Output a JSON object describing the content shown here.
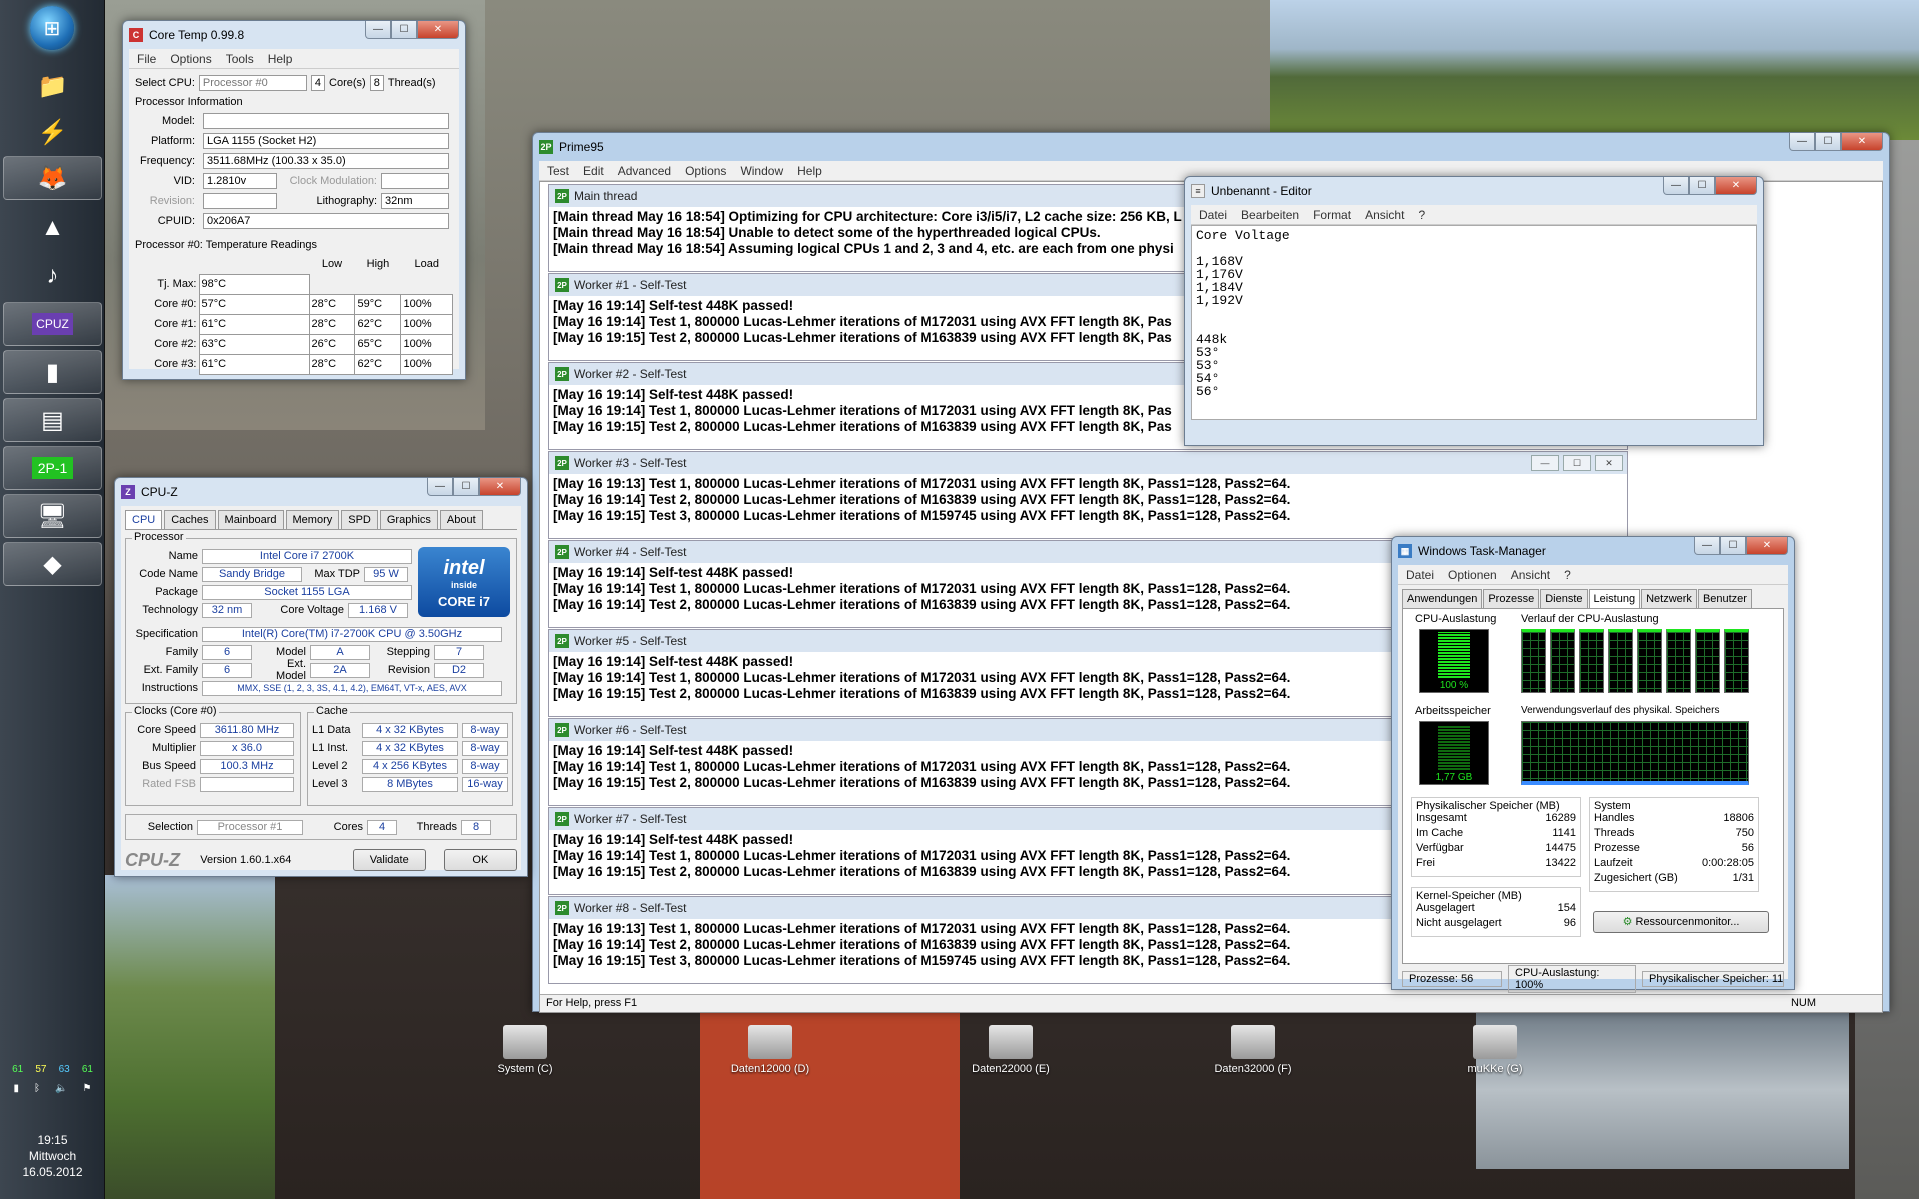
{
  "taskbar": {
    "items": [
      "start-orb",
      "libraries",
      "winamp",
      "firefox",
      "vlc",
      "itunes",
      "cpu-z",
      "prime95",
      "hardware-monitor",
      "task-manager",
      "windows-explorer"
    ],
    "tray_temps": {
      "t1": "61",
      "t2": "57",
      "t3": "63",
      "t4": "61"
    },
    "clock_time": "19:15",
    "clock_day": "Mittwoch",
    "clock_date": "16.05.2012"
  },
  "coretemp": {
    "title": "Core Temp 0.99.8",
    "menu": [
      "File",
      "Options",
      "Tools",
      "Help"
    ],
    "select_cpu_label": "Select CPU:",
    "select_cpu_value": "Processor #0",
    "cores": "4",
    "cores_label": "Core(s)",
    "threads": "8",
    "threads_label": "Thread(s)",
    "info_header": "Processor Information",
    "model_label": "Model:",
    "model_value": "",
    "platform_label": "Platform:",
    "platform_value": "LGA 1155 (Socket H2)",
    "frequency_label": "Frequency:",
    "frequency_value": "3511.68MHz (100.33 x 35.0)",
    "vid_label": "VID:",
    "vid_value": "1.2810v",
    "clock_mod_label": "Clock Modulation:",
    "revision_label": "Revision:",
    "lithography_label": "Lithography:",
    "lithography_value": "32nm",
    "cpuid_label": "CPUID:",
    "cpuid_value": "0x206A7",
    "temp_header": "Processor #0: Temperature Readings",
    "cols": [
      "Low",
      "High",
      "Load"
    ],
    "tjmax_label": "Tj. Max:",
    "tjmax_value": "98°C",
    "cores_rows": [
      {
        "name": "Core #0:",
        "temp": "57°C",
        "low": "28°C",
        "high": "59°C",
        "load": "100%"
      },
      {
        "name": "Core #1:",
        "temp": "61°C",
        "low": "28°C",
        "high": "62°C",
        "load": "100%"
      },
      {
        "name": "Core #2:",
        "temp": "63°C",
        "low": "26°C",
        "high": "65°C",
        "load": "100%"
      },
      {
        "name": "Core #3:",
        "temp": "61°C",
        "low": "28°C",
        "high": "62°C",
        "load": "100%"
      }
    ]
  },
  "cpuz": {
    "title": "CPU-Z",
    "tabs": [
      "CPU",
      "Caches",
      "Mainboard",
      "Memory",
      "SPD",
      "Graphics",
      "About"
    ],
    "processor_group": "Processor",
    "name_label": "Name",
    "name_value": "Intel Core i7 2700K",
    "codename_label": "Code Name",
    "codename_value": "Sandy Bridge",
    "maxtdp_label": "Max TDP",
    "maxtdp_value": "95 W",
    "package_label": "Package",
    "package_value": "Socket 1155 LGA",
    "technology_label": "Technology",
    "technology_value": "32 nm",
    "corevoltage_label": "Core Voltage",
    "corevoltage_value": "1.168 V",
    "intel_line1": "intel",
    "intel_line2": "inside",
    "intel_line3": "CORE i7",
    "spec_label": "Specification",
    "spec_value": "Intel(R) Core(TM) i7-2700K CPU @ 3.50GHz",
    "family_label": "Family",
    "family_value": "6",
    "model_label": "Model",
    "model_value": "A",
    "stepping_label": "Stepping",
    "stepping_value": "7",
    "extfamily_label": "Ext. Family",
    "extfamily_value": "6",
    "extmodel_label": "Ext. Model",
    "extmodel_value": "2A",
    "revision_label": "Revision",
    "revision_value": "D2",
    "instr_label": "Instructions",
    "instr_value": "MMX, SSE (1, 2, 3, 3S, 4.1, 4.2), EM64T, VT-x, AES, AVX",
    "clocks_group": "Clocks (Core #0)",
    "corespeed_label": "Core Speed",
    "corespeed_value": "3611.80 MHz",
    "multiplier_label": "Multiplier",
    "multiplier_value": "x 36.0",
    "busspeed_label": "Bus Speed",
    "busspeed_value": "100.3 MHz",
    "ratedfsb_label": "Rated FSB",
    "cache_group": "Cache",
    "cache_rows": [
      {
        "name": "L1 Data",
        "size": "4 x 32 KBytes",
        "way": "8-way"
      },
      {
        "name": "L1 Inst.",
        "size": "4 x 32 KBytes",
        "way": "8-way"
      },
      {
        "name": "Level 2",
        "size": "4 x 256 KBytes",
        "way": "8-way"
      },
      {
        "name": "Level 3",
        "size": "8 MBytes",
        "way": "16-way"
      }
    ],
    "selection_label": "Selection",
    "selection_value": "Processor #1",
    "cores_label": "Cores",
    "cores_value": "4",
    "threads_label": "Threads",
    "threads_value": "8",
    "logo": "CPU-Z",
    "version": "Version 1.60.1.x64",
    "validate": "Validate",
    "ok": "OK"
  },
  "prime95": {
    "title": "Prime95",
    "menu": [
      "Test",
      "Edit",
      "Advanced",
      "Options",
      "Window",
      "Help"
    ],
    "children": [
      {
        "title": "Main thread",
        "lines": [
          "[Main thread May 16 18:54] Optimizing for CPU architecture: Core i3/i5/i7, L2 cache size: 256 KB, L",
          "[Main thread May 16 18:54] Unable to detect some of the hyperthreaded logical CPUs.",
          "[Main thread May 16 18:54] Assuming logical CPUs 1 and 2, 3 and 4, etc. are each from one physi"
        ]
      },
      {
        "title": "Worker #1 - Self-Test",
        "lines": [
          "[May 16 19:14] Self-test 448K passed!",
          "[May 16 19:14] Test 1, 800000 Lucas-Lehmer iterations of M172031 using AVX FFT length 8K, Pas",
          "[May 16 19:15] Test 2, 800000 Lucas-Lehmer iterations of M163839 using AVX FFT length 8K, Pas"
        ]
      },
      {
        "title": "Worker #2 - Self-Test",
        "lines": [
          "[May 16 19:14] Self-test 448K passed!",
          "[May 16 19:14] Test 1, 800000 Lucas-Lehmer iterations of M172031 using AVX FFT length 8K, Pas",
          "[May 16 19:15] Test 2, 800000 Lucas-Lehmer iterations of M163839 using AVX FFT length 8K, Pas"
        ]
      },
      {
        "title": "Worker #3 - Self-Test",
        "lines": [
          "[May 16 19:13] Test 1, 800000 Lucas-Lehmer iterations of M172031 using AVX FFT length 8K, Pass1=128, Pass2=64.",
          "[May 16 19:14] Test 2, 800000 Lucas-Lehmer iterations of M163839 using AVX FFT length 8K, Pass1=128, Pass2=64.",
          "[May 16 19:15] Test 3, 800000 Lucas-Lehmer iterations of M159745 using AVX FFT length 8K, Pass1=128, Pass2=64."
        ]
      },
      {
        "title": "Worker #4 - Self-Test",
        "lines": [
          "[May 16 19:14] Self-test 448K passed!",
          "[May 16 19:14] Test 1, 800000 Lucas-Lehmer iterations of M172031 using AVX FFT length 8K, Pass1=128, Pass2=64.",
          "[May 16 19:14] Test 2, 800000 Lucas-Lehmer iterations of M163839 using AVX FFT length 8K, Pass1=128, Pass2=64."
        ]
      },
      {
        "title": "Worker #5 - Self-Test",
        "lines": [
          "[May 16 19:14] Self-test 448K passed!",
          "[May 16 19:14] Test 1, 800000 Lucas-Lehmer iterations of M172031 using AVX FFT length 8K, Pass1=128, Pass2=64.",
          "[May 16 19:15] Test 2, 800000 Lucas-Lehmer iterations of M163839 using AVX FFT length 8K, Pass1=128, Pass2=64."
        ]
      },
      {
        "title": "Worker #6 - Self-Test",
        "lines": [
          "[May 16 19:14] Self-test 448K passed!",
          "[May 16 19:14] Test 1, 800000 Lucas-Lehmer iterations of M172031 using AVX FFT length 8K, Pass1=128, Pass2=64.",
          "[May 16 19:15] Test 2, 800000 Lucas-Lehmer iterations of M163839 using AVX FFT length 8K, Pass1=128, Pass2=64."
        ]
      },
      {
        "title": "Worker #7 - Self-Test",
        "lines": [
          "[May 16 19:14] Self-test 448K passed!",
          "[May 16 19:14] Test 1, 800000 Lucas-Lehmer iterations of M172031 using AVX FFT length 8K, Pass1=128, Pass2=64.",
          "[May 16 19:15] Test 2, 800000 Lucas-Lehmer iterations of M163839 using AVX FFT length 8K, Pass1=128, Pass2=64."
        ]
      },
      {
        "title": "Worker #8 - Self-Test",
        "lines": [
          "[May 16 19:13] Test 1, 800000 Lucas-Lehmer iterations of M172031 using AVX FFT length 8K, Pass1=128, Pass2=64.",
          "[May 16 19:14] Test 2, 800000 Lucas-Lehmer iterations of M163839 using AVX FFT length 8K, Pass1=128, Pass2=64.",
          "[May 16 19:15] Test 3, 800000 Lucas-Lehmer iterations of M159745 using AVX FFT length 8K, Pass1=128, Pass2=64."
        ]
      }
    ],
    "status": "For Help, press F1",
    "status_num": "NUM"
  },
  "editor": {
    "title": "Unbenannt - Editor",
    "menu": [
      "Datei",
      "Bearbeiten",
      "Format",
      "Ansicht",
      "?"
    ],
    "text": "Core Voltage\n\n1,168V\n1,176V\n1,184V\n1,192V\n\n\n448k\n53°\n53°\n54°\n56°"
  },
  "taskmgr": {
    "title": "Windows Task-Manager",
    "menu": [
      "Datei",
      "Optionen",
      "Ansicht",
      "?"
    ],
    "tabs": [
      "Anwendungen",
      "Prozesse",
      "Dienste",
      "Leistung",
      "Netzwerk",
      "Benutzer"
    ],
    "cpu_label": "CPU-Auslastung",
    "cpu_value": "100 %",
    "cpu_fraction": 1.0,
    "cpu_history_label": "Verlauf der CPU-Auslastung",
    "mem_label": "Arbeitsspeicher",
    "mem_value": "1,77 GB",
    "mem_history_label": "Verwendungsverlauf des physikal. Speichers",
    "phys_header": "Physikalischer Speicher (MB)",
    "phys_rows": [
      {
        "k": "Insgesamt",
        "v": "16289"
      },
      {
        "k": "Im Cache",
        "v": "1141"
      },
      {
        "k": "Verfügbar",
        "v": "14475"
      },
      {
        "k": "Frei",
        "v": "13422"
      }
    ],
    "kernel_header": "Kernel-Speicher (MB)",
    "kernel_rows": [
      {
        "k": "Ausgelagert",
        "v": "154"
      },
      {
        "k": "Nicht ausgelagert",
        "v": "96"
      }
    ],
    "sys_header": "System",
    "sys_rows": [
      {
        "k": "Handles",
        "v": "18806"
      },
      {
        "k": "Threads",
        "v": "750"
      },
      {
        "k": "Prozesse",
        "v": "56"
      },
      {
        "k": "Laufzeit",
        "v": "0:00:28:05"
      },
      {
        "k": "Zugesichert (GB)",
        "v": "1/31"
      }
    ],
    "resmon": "Ressourcenmonitor...",
    "status_procs": "Prozesse: 56",
    "status_cpu": "CPU-Auslastung: 100%",
    "status_mem": "Physikalischer Speicher: 11"
  },
  "desktop_icons": [
    {
      "label": "System (C)"
    },
    {
      "label": "Daten12000 (D)"
    },
    {
      "label": "Daten22000 (E)"
    },
    {
      "label": "Daten32000 (F)"
    },
    {
      "label": "muKKe (G)"
    }
  ],
  "colors": {
    "prime_icon": "#2d8b2d",
    "monitor_green": "#1ee51e",
    "cpuz_blue": "#1a3fa0"
  }
}
